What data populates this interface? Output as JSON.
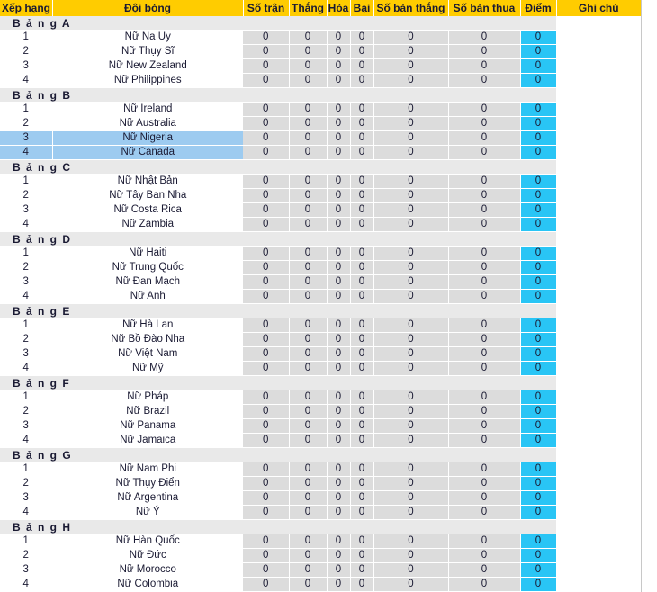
{
  "table": {
    "columns": [
      {
        "key": "rank",
        "label": "Xếp hạng"
      },
      {
        "key": "team",
        "label": "Đội bóng"
      },
      {
        "key": "played",
        "label": "Số trận"
      },
      {
        "key": "win",
        "label": "Thắng"
      },
      {
        "key": "draw",
        "label": "Hòa"
      },
      {
        "key": "loss",
        "label": "Bại"
      },
      {
        "key": "gf",
        "label": "Số bàn thắng"
      },
      {
        "key": "ga",
        "label": "Số bàn thua"
      },
      {
        "key": "pts",
        "label": "Điểm"
      },
      {
        "key": "note",
        "label": "Ghi chú"
      }
    ],
    "colors": {
      "header_bg": "#ffcc00",
      "group_bg": "#e9e9e9",
      "stat_bg": "#dcdcdc",
      "points_bg": "#29c5f5",
      "highlight_bg": "#9dcbf0",
      "text": "#1a1a33"
    },
    "groups": [
      {
        "label": "B ả n g   A",
        "rows": [
          {
            "rank": "1",
            "team": "Nữ Na Uy",
            "played": "0",
            "win": "0",
            "draw": "0",
            "loss": "0",
            "gf": "0",
            "ga": "0",
            "pts": "0",
            "note": "",
            "highlight": false
          },
          {
            "rank": "2",
            "team": "Nữ Thụy Sĩ",
            "played": "0",
            "win": "0",
            "draw": "0",
            "loss": "0",
            "gf": "0",
            "ga": "0",
            "pts": "0",
            "note": "",
            "highlight": false
          },
          {
            "rank": "3",
            "team": "Nữ New Zealand",
            "played": "0",
            "win": "0",
            "draw": "0",
            "loss": "0",
            "gf": "0",
            "ga": "0",
            "pts": "0",
            "note": "",
            "highlight": false
          },
          {
            "rank": "4",
            "team": "Nữ Philippines",
            "played": "0",
            "win": "0",
            "draw": "0",
            "loss": "0",
            "gf": "0",
            "ga": "0",
            "pts": "0",
            "note": "",
            "highlight": false
          }
        ]
      },
      {
        "label": "B ả n g   B",
        "rows": [
          {
            "rank": "1",
            "team": "Nữ Ireland",
            "played": "0",
            "win": "0",
            "draw": "0",
            "loss": "0",
            "gf": "0",
            "ga": "0",
            "pts": "0",
            "note": "",
            "highlight": false
          },
          {
            "rank": "2",
            "team": "Nữ Australia",
            "played": "0",
            "win": "0",
            "draw": "0",
            "loss": "0",
            "gf": "0",
            "ga": "0",
            "pts": "0",
            "note": "",
            "highlight": false
          },
          {
            "rank": "3",
            "team": "Nữ Nigeria",
            "played": "0",
            "win": "0",
            "draw": "0",
            "loss": "0",
            "gf": "0",
            "ga": "0",
            "pts": "0",
            "note": "",
            "highlight": true
          },
          {
            "rank": "4",
            "team": "Nữ Canada",
            "played": "0",
            "win": "0",
            "draw": "0",
            "loss": "0",
            "gf": "0",
            "ga": "0",
            "pts": "0",
            "note": "",
            "highlight": true
          }
        ]
      },
      {
        "label": "B ả n g   C",
        "rows": [
          {
            "rank": "1",
            "team": "Nữ Nhật Bản",
            "played": "0",
            "win": "0",
            "draw": "0",
            "loss": "0",
            "gf": "0",
            "ga": "0",
            "pts": "0",
            "note": "",
            "highlight": false
          },
          {
            "rank": "2",
            "team": "Nữ Tây Ban Nha",
            "played": "0",
            "win": "0",
            "draw": "0",
            "loss": "0",
            "gf": "0",
            "ga": "0",
            "pts": "0",
            "note": "",
            "highlight": false
          },
          {
            "rank": "3",
            "team": "Nữ Costa Rica",
            "played": "0",
            "win": "0",
            "draw": "0",
            "loss": "0",
            "gf": "0",
            "ga": "0",
            "pts": "0",
            "note": "",
            "highlight": false
          },
          {
            "rank": "4",
            "team": "Nữ Zambia",
            "played": "0",
            "win": "0",
            "draw": "0",
            "loss": "0",
            "gf": "0",
            "ga": "0",
            "pts": "0",
            "note": "",
            "highlight": false
          }
        ]
      },
      {
        "label": "B ả n g   D",
        "rows": [
          {
            "rank": "1",
            "team": "Nữ Haiti",
            "played": "0",
            "win": "0",
            "draw": "0",
            "loss": "0",
            "gf": "0",
            "ga": "0",
            "pts": "0",
            "note": "",
            "highlight": false
          },
          {
            "rank": "2",
            "team": "Nữ Trung Quốc",
            "played": "0",
            "win": "0",
            "draw": "0",
            "loss": "0",
            "gf": "0",
            "ga": "0",
            "pts": "0",
            "note": "",
            "highlight": false
          },
          {
            "rank": "3",
            "team": "Nữ Đan Mạch",
            "played": "0",
            "win": "0",
            "draw": "0",
            "loss": "0",
            "gf": "0",
            "ga": "0",
            "pts": "0",
            "note": "",
            "highlight": false
          },
          {
            "rank": "4",
            "team": "Nữ Anh",
            "played": "0",
            "win": "0",
            "draw": "0",
            "loss": "0",
            "gf": "0",
            "ga": "0",
            "pts": "0",
            "note": "",
            "highlight": false
          }
        ]
      },
      {
        "label": "B ả n g   E",
        "rows": [
          {
            "rank": "1",
            "team": "Nữ Hà Lan",
            "played": "0",
            "win": "0",
            "draw": "0",
            "loss": "0",
            "gf": "0",
            "ga": "0",
            "pts": "0",
            "note": "",
            "highlight": false
          },
          {
            "rank": "2",
            "team": "Nữ Bồ Đào Nha",
            "played": "0",
            "win": "0",
            "draw": "0",
            "loss": "0",
            "gf": "0",
            "ga": "0",
            "pts": "0",
            "note": "",
            "highlight": false
          },
          {
            "rank": "3",
            "team": "Nữ Việt Nam",
            "played": "0",
            "win": "0",
            "draw": "0",
            "loss": "0",
            "gf": "0",
            "ga": "0",
            "pts": "0",
            "note": "",
            "highlight": false
          },
          {
            "rank": "4",
            "team": "Nữ Mỹ",
            "played": "0",
            "win": "0",
            "draw": "0",
            "loss": "0",
            "gf": "0",
            "ga": "0",
            "pts": "0",
            "note": "",
            "highlight": false
          }
        ]
      },
      {
        "label": "B ả n g   F",
        "rows": [
          {
            "rank": "1",
            "team": "Nữ Pháp",
            "played": "0",
            "win": "0",
            "draw": "0",
            "loss": "0",
            "gf": "0",
            "ga": "0",
            "pts": "0",
            "note": "",
            "highlight": false
          },
          {
            "rank": "2",
            "team": "Nữ Brazil",
            "played": "0",
            "win": "0",
            "draw": "0",
            "loss": "0",
            "gf": "0",
            "ga": "0",
            "pts": "0",
            "note": "",
            "highlight": false
          },
          {
            "rank": "3",
            "team": "Nữ Panama",
            "played": "0",
            "win": "0",
            "draw": "0",
            "loss": "0",
            "gf": "0",
            "ga": "0",
            "pts": "0",
            "note": "",
            "highlight": false
          },
          {
            "rank": "4",
            "team": "Nữ Jamaica",
            "played": "0",
            "win": "0",
            "draw": "0",
            "loss": "0",
            "gf": "0",
            "ga": "0",
            "pts": "0",
            "note": "",
            "highlight": false
          }
        ]
      },
      {
        "label": "B ả n g   G",
        "rows": [
          {
            "rank": "1",
            "team": "Nữ Nam Phi",
            "played": "0",
            "win": "0",
            "draw": "0",
            "loss": "0",
            "gf": "0",
            "ga": "0",
            "pts": "0",
            "note": "",
            "highlight": false
          },
          {
            "rank": "2",
            "team": "Nữ Thụy Điển",
            "played": "0",
            "win": "0",
            "draw": "0",
            "loss": "0",
            "gf": "0",
            "ga": "0",
            "pts": "0",
            "note": "",
            "highlight": false
          },
          {
            "rank": "3",
            "team": "Nữ Argentina",
            "played": "0",
            "win": "0",
            "draw": "0",
            "loss": "0",
            "gf": "0",
            "ga": "0",
            "pts": "0",
            "note": "",
            "highlight": false
          },
          {
            "rank": "4",
            "team": "Nữ Ý",
            "played": "0",
            "win": "0",
            "draw": "0",
            "loss": "0",
            "gf": "0",
            "ga": "0",
            "pts": "0",
            "note": "",
            "highlight": false
          }
        ]
      },
      {
        "label": "B ả n g   H",
        "rows": [
          {
            "rank": "1",
            "team": "Nữ Hàn Quốc",
            "played": "0",
            "win": "0",
            "draw": "0",
            "loss": "0",
            "gf": "0",
            "ga": "0",
            "pts": "0",
            "note": "",
            "highlight": false
          },
          {
            "rank": "2",
            "team": "Nữ Đức",
            "played": "0",
            "win": "0",
            "draw": "0",
            "loss": "0",
            "gf": "0",
            "ga": "0",
            "pts": "0",
            "note": "",
            "highlight": false
          },
          {
            "rank": "3",
            "team": "Nữ Morocco",
            "played": "0",
            "win": "0",
            "draw": "0",
            "loss": "0",
            "gf": "0",
            "ga": "0",
            "pts": "0",
            "note": "",
            "highlight": false
          },
          {
            "rank": "4",
            "team": "Nữ Colombia",
            "played": "0",
            "win": "0",
            "draw": "0",
            "loss": "0",
            "gf": "0",
            "ga": "0",
            "pts": "0",
            "note": "",
            "highlight": false
          }
        ]
      }
    ]
  }
}
